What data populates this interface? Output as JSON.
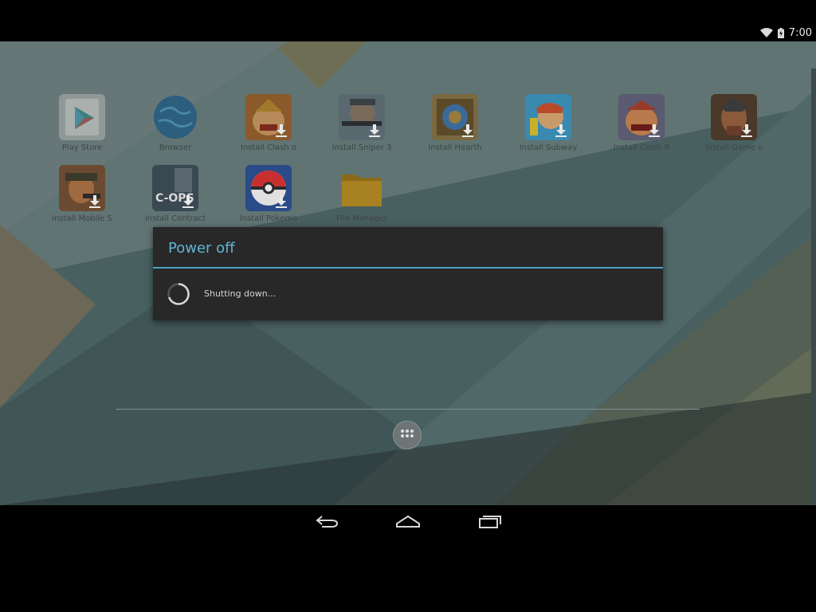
{
  "status_bar": {
    "time": "7:00",
    "wifi_icon": "wifi-icon",
    "battery_icon": "battery-charging-icon"
  },
  "apps": [
    {
      "label": "Play Store",
      "icon": "play-store-icon"
    },
    {
      "label": "Browser",
      "icon": "browser-globe-icon"
    },
    {
      "label": "Install Clash o",
      "icon": "clash-of-clans-icon"
    },
    {
      "label": "Install Sniper 3",
      "icon": "sniper-icon"
    },
    {
      "label": "Install Hearth",
      "icon": "hearthstone-icon"
    },
    {
      "label": "Install Subway",
      "icon": "subway-surfers-icon"
    },
    {
      "label": "Install Clash R",
      "icon": "clash-royale-icon"
    },
    {
      "label": "Install Game o",
      "icon": "game-of-war-icon"
    },
    {
      "label": "Install Mobile S",
      "icon": "mobile-strike-icon"
    },
    {
      "label": "Install Contract",
      "icon": "critical-ops-icon"
    },
    {
      "label": "Install Pokemo",
      "icon": "pokemon-go-icon"
    },
    {
      "label": "File Manager",
      "icon": "folder-icon"
    }
  ],
  "dialog": {
    "title": "Power off",
    "message": "Shutting down..."
  },
  "cops_text": "C-OPS",
  "dock": {
    "all_apps_icon": "all-apps-icon"
  },
  "nav": {
    "back_icon": "back-icon",
    "home_icon": "home-icon",
    "recents_icon": "recents-icon"
  },
  "colors": {
    "accent": "#5fb4d4",
    "dialog_bg": "#282828"
  }
}
